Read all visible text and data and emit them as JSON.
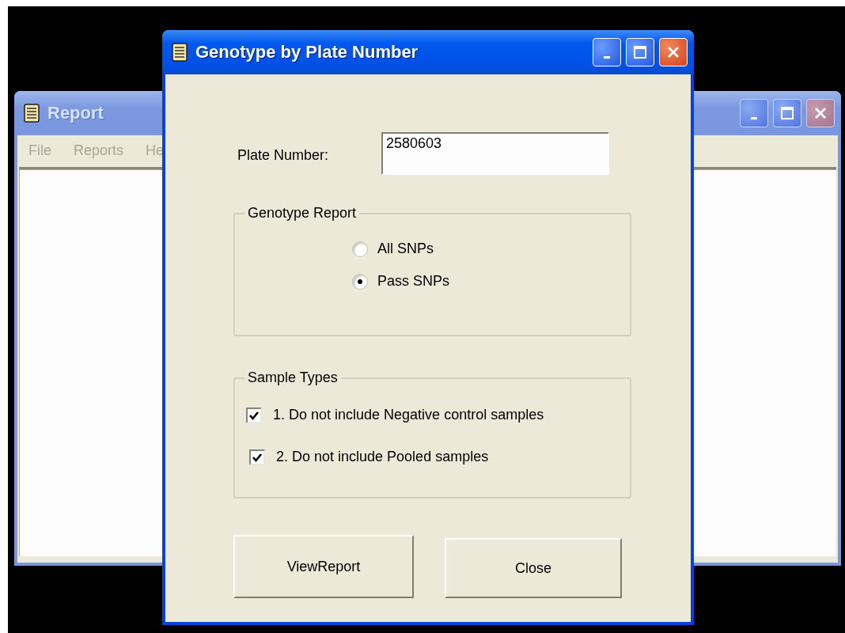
{
  "background_window": {
    "title": "Report",
    "active": false,
    "menu": [
      "File",
      "Reports",
      "He"
    ]
  },
  "dialog": {
    "title": "Genotype by Plate Number",
    "active": true,
    "plate_number": {
      "label": "Plate Number:",
      "value": "2580603"
    },
    "genotype_report": {
      "title": "Genotype Report",
      "options": [
        {
          "label": "All SNPs",
          "selected": false
        },
        {
          "label": "Pass SNPs",
          "selected": true
        }
      ]
    },
    "sample_types": {
      "title": "Sample Types",
      "options": [
        {
          "label": "1. Do not include Negative control samples",
          "checked": true
        },
        {
          "label": "2. Do not include Pooled samples",
          "checked": true
        }
      ]
    },
    "buttons": [
      "ViewReport",
      "Close"
    ]
  }
}
